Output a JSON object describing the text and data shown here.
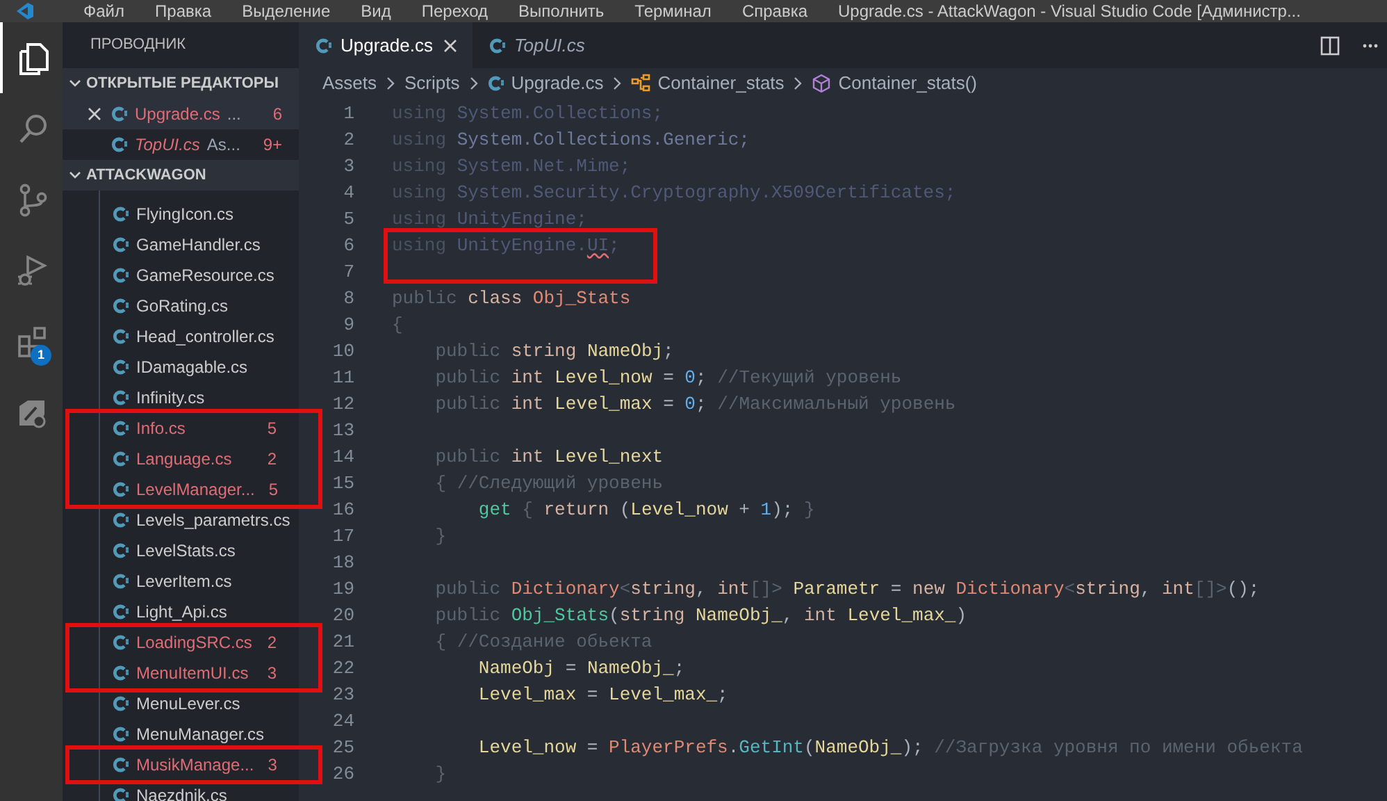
{
  "title_bar": {
    "menu": [
      "Файл",
      "Правка",
      "Выделение",
      "Вид",
      "Переход",
      "Выполнить",
      "Терминал",
      "Справка"
    ],
    "title": "Upgrade.cs - AttackWagon - Visual Studio Code [Администр..."
  },
  "activity_bar": [
    {
      "kind": "files",
      "selected": true
    },
    {
      "kind": "search",
      "selected": false
    },
    {
      "kind": "source",
      "selected": false
    },
    {
      "kind": "debug",
      "selected": false
    },
    {
      "kind": "extensions",
      "selected": false,
      "badge": "1"
    },
    {
      "kind": "remote",
      "selected": false
    }
  ],
  "sidebar": {
    "title": "ПРОВОДНИК",
    "open_editors": {
      "label": "ОТКРЫТЫЕ РЕДАКТОРЫ",
      "expanded": true,
      "items": [
        {
          "name": "Upgrade.cs",
          "detail": "...",
          "problems": "6",
          "selected": true,
          "preview": false,
          "has_errors": true
        },
        {
          "name": "TopUI.cs",
          "detail": "As...",
          "problems": "9+",
          "selected": false,
          "preview": true,
          "has_errors": true
        }
      ]
    },
    "folder": {
      "label": "ATTACKWAGON",
      "expanded": true,
      "items": [
        {
          "name": "FlyingIcon.cs",
          "has_errors": false,
          "highlighted": false
        },
        {
          "name": "GameHandler.cs",
          "has_errors": false,
          "highlighted": false
        },
        {
          "name": "GameResource.cs",
          "has_errors": false,
          "highlighted": false
        },
        {
          "name": "GoRating.cs",
          "has_errors": false,
          "highlighted": false
        },
        {
          "name": "Head_controller.cs",
          "has_errors": false,
          "highlighted": false
        },
        {
          "name": "IDamagable.cs",
          "has_errors": false,
          "highlighted": false
        },
        {
          "name": "Infinity.cs",
          "has_errors": false,
          "highlighted": false
        },
        {
          "name": "Info.cs",
          "problems": "5",
          "has_errors": true,
          "highlighted": true
        },
        {
          "name": "Language.cs",
          "problems": "2",
          "has_errors": true,
          "highlighted": true
        },
        {
          "name": "LevelManager...",
          "problems": "5",
          "has_errors": true,
          "highlighted": true
        },
        {
          "name": "Levels_parametrs.cs",
          "has_errors": false,
          "highlighted": false
        },
        {
          "name": "LevelStats.cs",
          "has_errors": false,
          "highlighted": false
        },
        {
          "name": "LeverItem.cs",
          "has_errors": false,
          "highlighted": false
        },
        {
          "name": "Light_Api.cs",
          "has_errors": false,
          "highlighted": false
        },
        {
          "name": "LoadingSRC.cs",
          "problems": "2",
          "has_errors": true,
          "highlighted": true
        },
        {
          "name": "MenuItemUI.cs",
          "problems": "3",
          "has_errors": true,
          "highlighted": true
        },
        {
          "name": "MenuLever.cs",
          "has_errors": false,
          "highlighted": false
        },
        {
          "name": "MenuManager.cs",
          "has_errors": false,
          "highlighted": false
        },
        {
          "name": "MusikManage...",
          "problems": "3",
          "has_errors": true,
          "highlighted": true
        },
        {
          "name": "Naezdnik.cs",
          "has_errors": false,
          "highlighted": false
        }
      ]
    }
  },
  "tabs": [
    {
      "label": "Upgrade.cs",
      "selected": true,
      "preview": false
    },
    {
      "label": "TopUI.cs",
      "selected": false,
      "preview": true
    }
  ],
  "breadcrumbs": [
    {
      "kind": "folder",
      "label": "Assets"
    },
    {
      "kind": "folder",
      "label": "Scripts"
    },
    {
      "kind": "file",
      "label": "Upgrade.cs"
    },
    {
      "kind": "class",
      "label": "Container_stats"
    },
    {
      "kind": "method",
      "label": "Container_stats()"
    }
  ],
  "code": {
    "lines": [
      {
        "number": "1",
        "highlighted": false,
        "tokens": [
          {
            "text": "using ",
            "kind": "u"
          },
          {
            "text": "System.Collections;",
            "kind": "s"
          }
        ]
      },
      {
        "number": "2",
        "highlighted": false,
        "tokens": [
          {
            "text": "using ",
            "kind": "u"
          },
          {
            "text": "System.Collections.Generic;",
            "kind": "s2"
          }
        ]
      },
      {
        "number": "3",
        "highlighted": false,
        "tokens": [
          {
            "text": "using ",
            "kind": "u"
          },
          {
            "text": "System.Net.Mime;",
            "kind": "s"
          }
        ]
      },
      {
        "number": "4",
        "highlighted": false,
        "tokens": [
          {
            "text": "using ",
            "kind": "u"
          },
          {
            "text": "System.Security.Cryptography.X509Certificates;",
            "kind": "s"
          }
        ]
      },
      {
        "number": "5",
        "highlighted": false,
        "tokens": [
          {
            "text": "using ",
            "kind": "u"
          },
          {
            "text": "UnityEngine;",
            "kind": "s"
          }
        ]
      },
      {
        "number": "6",
        "highlighted": true,
        "tokens": [
          {
            "text": "using ",
            "kind": "u"
          },
          {
            "text": "UnityEngine.",
            "kind": "s"
          },
          {
            "text": "UI",
            "kind": "e"
          },
          {
            "text": ";",
            "kind": "s"
          }
        ]
      },
      {
        "number": "7",
        "highlighted": false
      },
      {
        "number": "8",
        "highlighted": false,
        "tokens": [
          {
            "text": "public ",
            "kind": "k"
          },
          {
            "text": "class ",
            "kind": "t"
          },
          {
            "text": "Obj_Stats",
            "kind": "c"
          }
        ]
      },
      {
        "number": "9",
        "highlighted": false,
        "tokens": [
          {
            "text": "{",
            "kind": "k"
          }
        ]
      },
      {
        "number": "10",
        "highlighted": false,
        "tokens": [
          {
            "text": "    public ",
            "kind": "k"
          },
          {
            "text": "string ",
            "kind": "t"
          },
          {
            "text": "NameObj",
            "kind": "v"
          },
          {
            "text": ";",
            "kind": "p"
          }
        ]
      },
      {
        "number": "11",
        "highlighted": false,
        "tokens": [
          {
            "text": "    public ",
            "kind": "k"
          },
          {
            "text": "int ",
            "kind": "t"
          },
          {
            "text": "Level_now",
            "kind": "v"
          },
          {
            "text": " = ",
            "kind": "p"
          },
          {
            "text": "0",
            "kind": "n"
          },
          {
            "text": "; ",
            "kind": "p"
          },
          {
            "text": "//Текущий уровень",
            "kind": "m"
          }
        ]
      },
      {
        "number": "12",
        "highlighted": false,
        "tokens": [
          {
            "text": "    public ",
            "kind": "k"
          },
          {
            "text": "int ",
            "kind": "t"
          },
          {
            "text": "Level_max",
            "kind": "v"
          },
          {
            "text": " = ",
            "kind": "p"
          },
          {
            "text": "0",
            "kind": "n"
          },
          {
            "text": "; ",
            "kind": "p"
          },
          {
            "text": "//Максимальный уровень",
            "kind": "m"
          }
        ]
      },
      {
        "number": "13",
        "highlighted": false
      },
      {
        "number": "14",
        "highlighted": false,
        "tokens": [
          {
            "text": "    public ",
            "kind": "k"
          },
          {
            "text": "int ",
            "kind": "t"
          },
          {
            "text": "Level_next",
            "kind": "v"
          }
        ]
      },
      {
        "number": "15",
        "highlighted": false,
        "tokens": [
          {
            "text": "    { ",
            "kind": "k"
          },
          {
            "text": "//Следующий уровень",
            "kind": "m"
          }
        ]
      },
      {
        "number": "16",
        "highlighted": false,
        "tokens": [
          {
            "text": "        get ",
            "kind": "g"
          },
          {
            "text": "{ ",
            "kind": "k"
          },
          {
            "text": "return ",
            "kind": "t"
          },
          {
            "text": "(",
            "kind": "p"
          },
          {
            "text": "Level_now",
            "kind": "v"
          },
          {
            "text": " + ",
            "kind": "p"
          },
          {
            "text": "1",
            "kind": "n"
          },
          {
            "text": "); ",
            "kind": "p"
          },
          {
            "text": "}",
            "kind": "k"
          }
        ]
      },
      {
        "number": "17",
        "highlighted": false,
        "tokens": [
          {
            "text": "    }",
            "kind": "k"
          }
        ]
      },
      {
        "number": "18",
        "highlighted": false
      },
      {
        "number": "19",
        "highlighted": false,
        "tokens": [
          {
            "text": "    public ",
            "kind": "k"
          },
          {
            "text": "Dictionary",
            "kind": "c"
          },
          {
            "text": "<",
            "kind": "k"
          },
          {
            "text": "string",
            "kind": "t"
          },
          {
            "text": ", ",
            "kind": "p"
          },
          {
            "text": "int",
            "kind": "t"
          },
          {
            "text": "[]> ",
            "kind": "k"
          },
          {
            "text": "Parametr",
            "kind": "v"
          },
          {
            "text": " = ",
            "kind": "p"
          },
          {
            "text": "new ",
            "kind": "t"
          },
          {
            "text": "Dictionary",
            "kind": "c"
          },
          {
            "text": "<",
            "kind": "k"
          },
          {
            "text": "string",
            "kind": "t"
          },
          {
            "text": ", ",
            "kind": "p"
          },
          {
            "text": "int",
            "kind": "t"
          },
          {
            "text": "[]>",
            "kind": "k"
          },
          {
            "text": "();",
            "kind": "p"
          }
        ]
      },
      {
        "number": "20",
        "highlighted": false,
        "tokens": [
          {
            "text": "    public ",
            "kind": "k"
          },
          {
            "text": "Obj_Stats",
            "kind": "g"
          },
          {
            "text": "(",
            "kind": "p"
          },
          {
            "text": "string ",
            "kind": "t"
          },
          {
            "text": "NameObj_",
            "kind": "v"
          },
          {
            "text": ", ",
            "kind": "p"
          },
          {
            "text": "int ",
            "kind": "t"
          },
          {
            "text": "Level_max_",
            "kind": "v"
          },
          {
            "text": ")",
            "kind": "p"
          }
        ]
      },
      {
        "number": "21",
        "highlighted": false,
        "tokens": [
          {
            "text": "    { ",
            "kind": "k"
          },
          {
            "text": "//Создание обьекта",
            "kind": "m"
          }
        ]
      },
      {
        "number": "22",
        "highlighted": false,
        "tokens": [
          {
            "text": "        NameObj",
            "kind": "v"
          },
          {
            "text": " = ",
            "kind": "p"
          },
          {
            "text": "NameObj_",
            "kind": "v"
          },
          {
            "text": ";",
            "kind": "p"
          }
        ]
      },
      {
        "number": "23",
        "highlighted": false,
        "tokens": [
          {
            "text": "        Level_max",
            "kind": "v"
          },
          {
            "text": " = ",
            "kind": "p"
          },
          {
            "text": "Level_max_",
            "kind": "v"
          },
          {
            "text": ";",
            "kind": "p"
          }
        ]
      },
      {
        "number": "24",
        "highlighted": false
      },
      {
        "number": "25",
        "highlighted": false,
        "tokens": [
          {
            "text": "        Level_now",
            "kind": "v"
          },
          {
            "text": " = ",
            "kind": "p"
          },
          {
            "text": "PlayerPrefs",
            "kind": "c"
          },
          {
            "text": ".",
            "kind": "p"
          },
          {
            "text": "GetInt",
            "kind": "f"
          },
          {
            "text": "(",
            "kind": "p"
          },
          {
            "text": "NameObj_",
            "kind": "v"
          },
          {
            "text": "); ",
            "kind": "p"
          },
          {
            "text": "//Загрузка уровня по имени обьекта",
            "kind": "m"
          }
        ]
      },
      {
        "number": "26",
        "highlighted": false,
        "tokens": [
          {
            "text": "    }",
            "kind": "k"
          }
        ]
      }
    ]
  }
}
